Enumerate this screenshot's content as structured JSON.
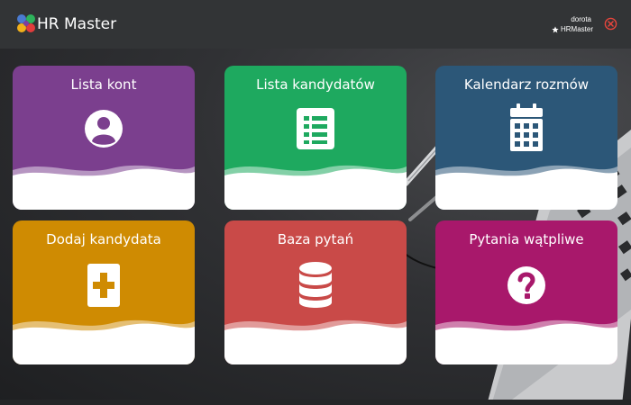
{
  "header": {
    "app_title": "HR Master",
    "user_name": "dorota",
    "user_role": "HRMaster",
    "logo_icon": "hr-master-logo-icon",
    "logout_icon": "close-circle-icon"
  },
  "tiles": [
    {
      "label": "Lista kont",
      "icon": "user-avatar-icon",
      "color": "#7b3f8e"
    },
    {
      "label": "Lista kandydatów",
      "icon": "list-icon",
      "color": "#1ea95f"
    },
    {
      "label": "Kalendarz rozmów",
      "icon": "calendar-icon",
      "color": "#2c5778"
    },
    {
      "label": "Dodaj kandydata",
      "icon": "plus-box-icon",
      "color": "#cf8b02"
    },
    {
      "label": "Baza pytań",
      "icon": "database-icon",
      "color": "#c94a48"
    },
    {
      "label": "Pytania wątpliwe",
      "icon": "question-circle-icon",
      "color": "#a8186b"
    }
  ]
}
